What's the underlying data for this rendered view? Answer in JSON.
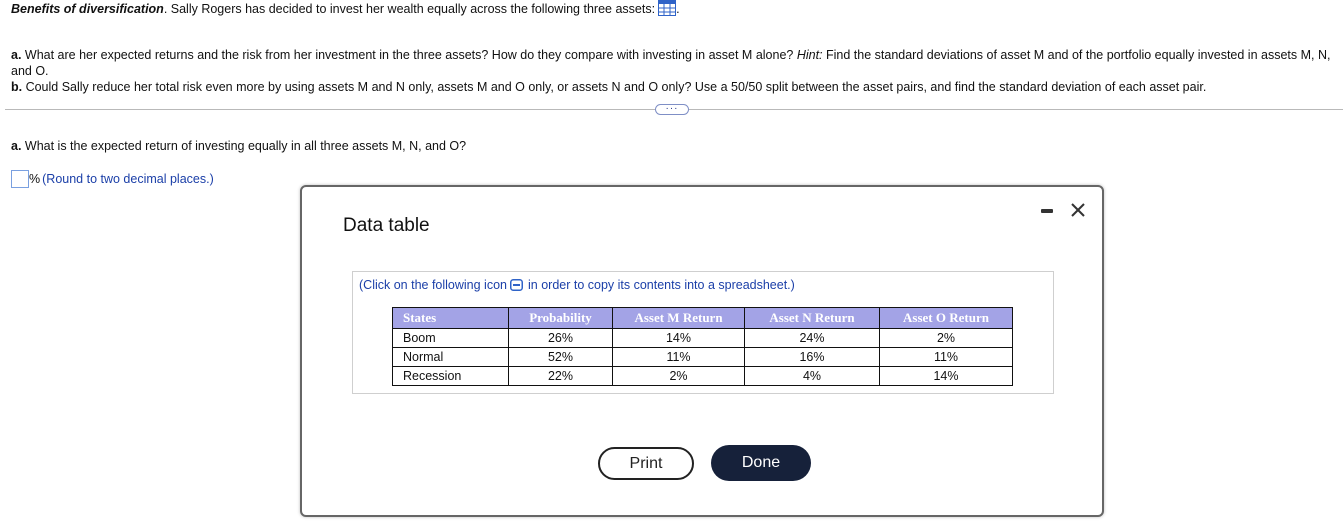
{
  "problem": {
    "title_bold": "Benefits of diversification",
    "title_rest": ". Sally Rogers has decided to invest her wealth equally across the following three assets:",
    "title_end": ".",
    "part_a_label": "a.",
    "part_a_text": " What are her expected returns and the risk from her investment in the three assets?  How do they compare with investing in asset M alone?  ",
    "part_a_hint_label": "Hint:",
    "part_a_hint": "  Find the standard deviations of asset M and of the portfolio equally invested in assets M, N, and O.",
    "part_b_label": "b.",
    "part_b_text": " Could Sally reduce her total risk even more by using assets M and N only, assets M and O only, or assets N and O only?  Use a 50/50 split between the asset pairs, and find the standard deviation of each asset pair."
  },
  "expander_label": "···",
  "question": {
    "label": "a.",
    "text": " What is the expected return of investing equally in all three assets M, N, and O?",
    "unit": "%",
    "hint": " (Round to two decimal places.)"
  },
  "dialog": {
    "title": "Data table",
    "copy_note_before": "(Click on the following icon",
    "copy_note_after": "in order to copy its contents into a spreadsheet.)",
    "headers": [
      "States",
      "Probability",
      "Asset M Return",
      "Asset N Return",
      "Asset O Return"
    ],
    "rows": [
      [
        "Boom",
        "26%",
        "14%",
        "24%",
        "2%"
      ],
      [
        "Normal",
        "52%",
        "11%",
        "16%",
        "11%"
      ],
      [
        "Recession",
        "22%",
        "2%",
        "4%",
        "14%"
      ]
    ],
    "print_label": "Print",
    "done_label": "Done"
  },
  "colors": {
    "header_bg": "#a3a3e6",
    "done_bg": "#16213a",
    "link_blue": "#1b3fa8"
  }
}
